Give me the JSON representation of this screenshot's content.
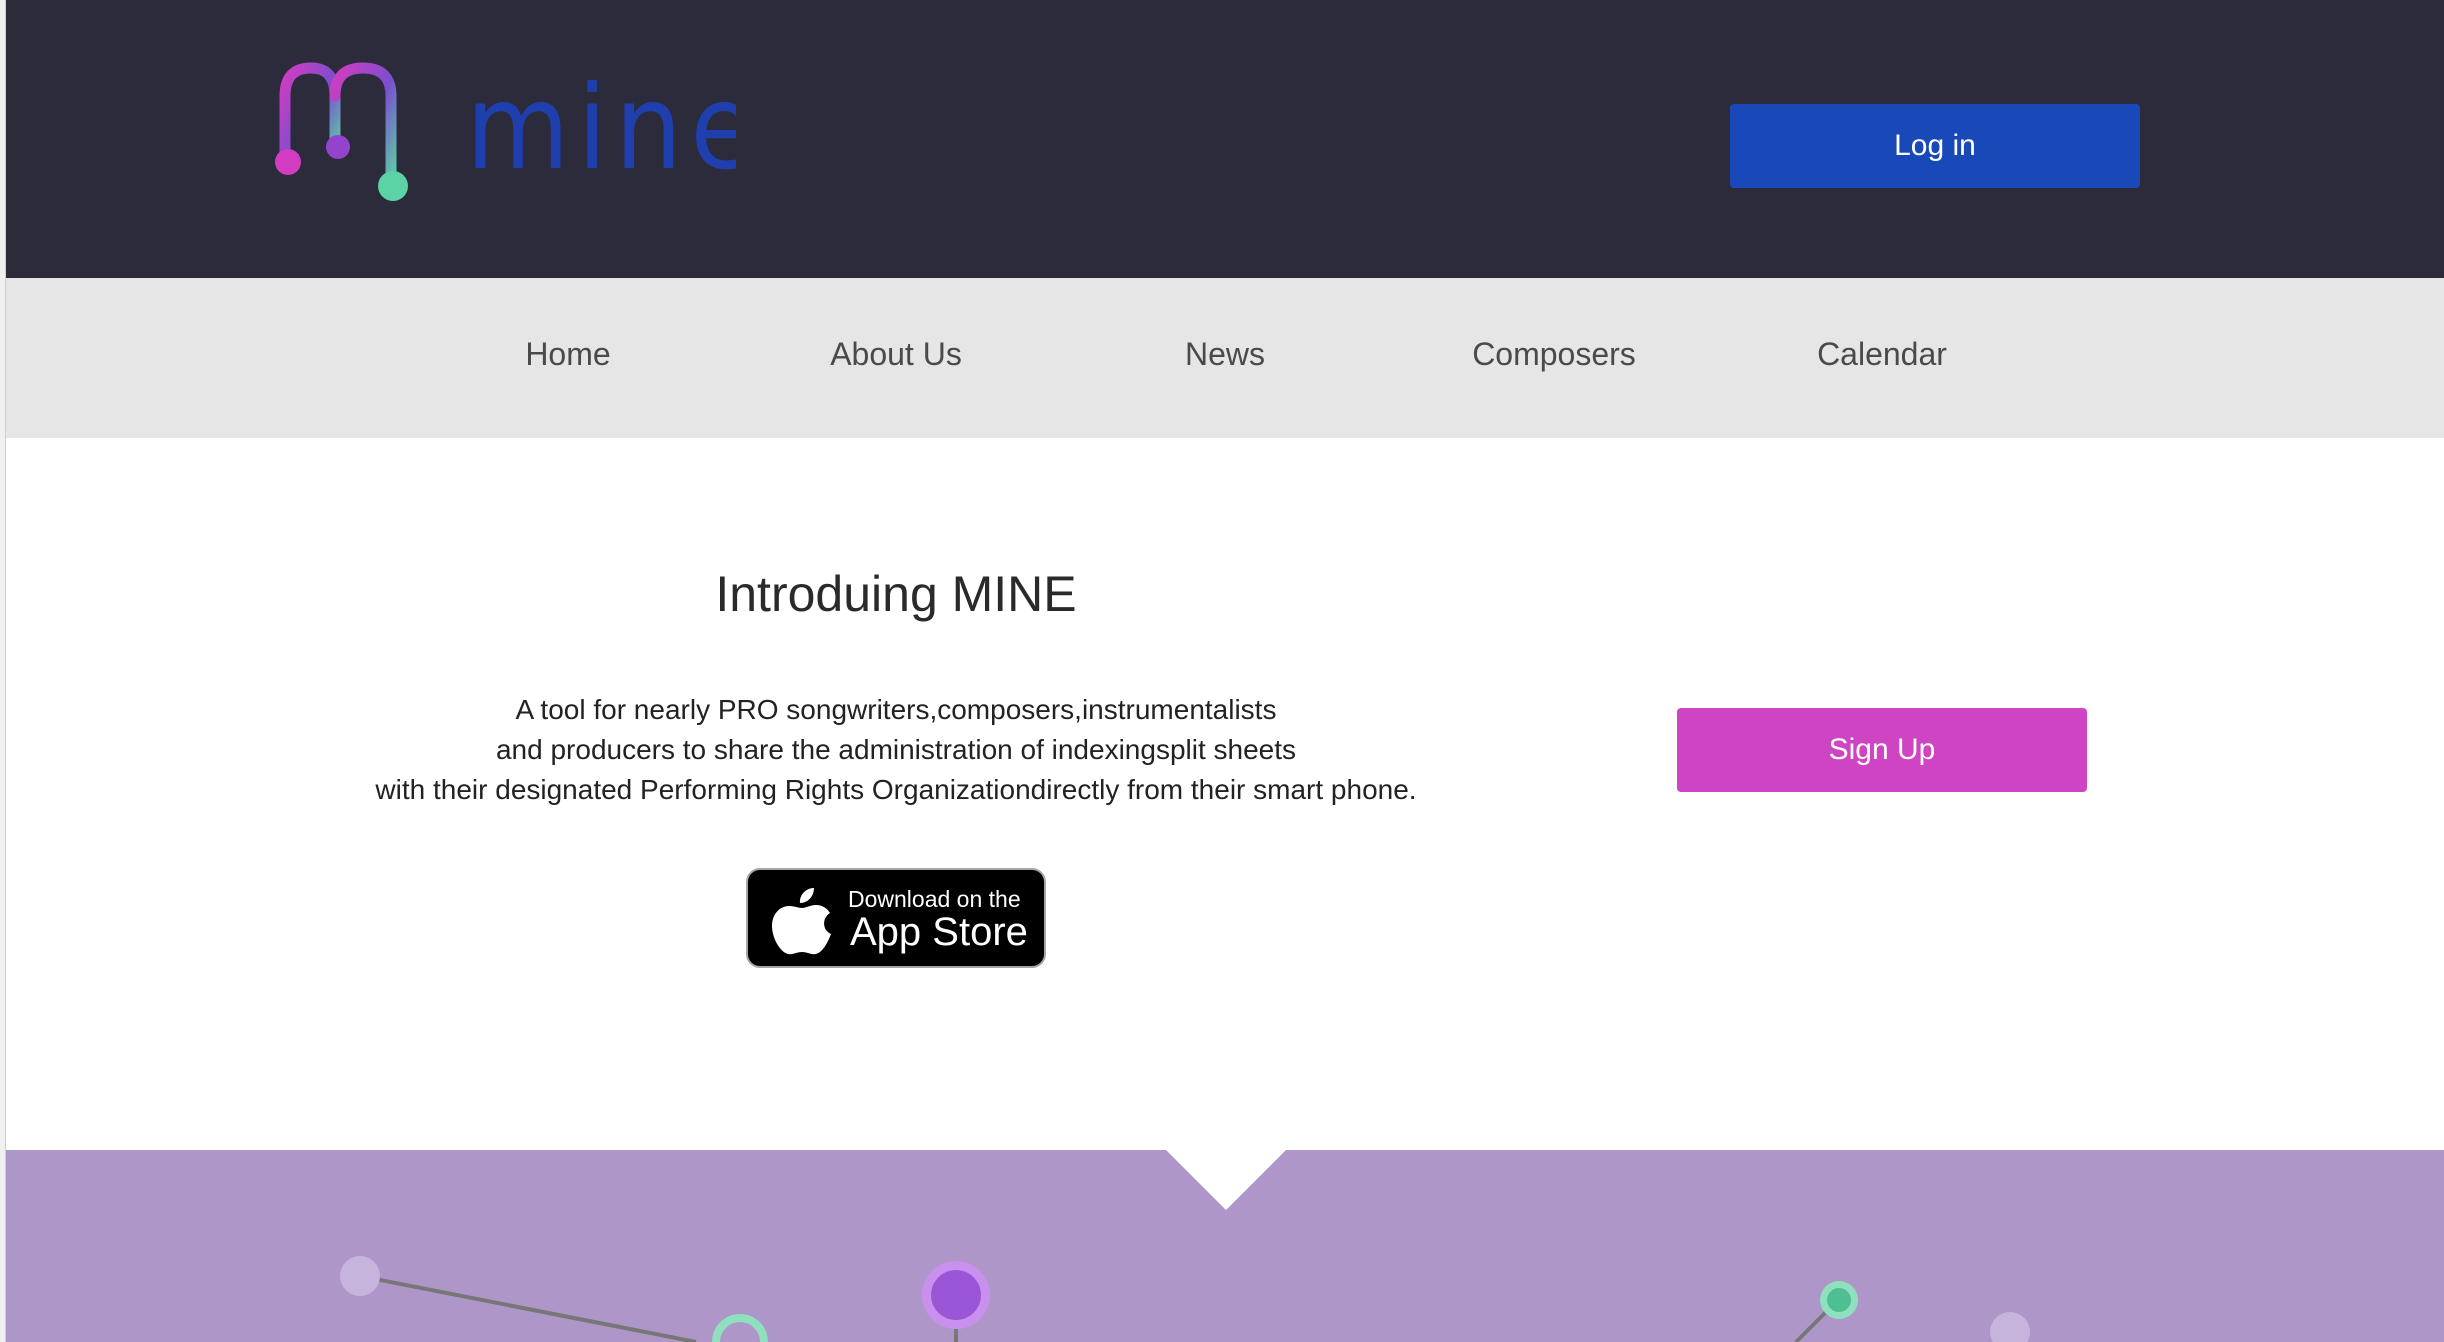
{
  "header": {
    "logo_text": "mine",
    "login_label": "Log in"
  },
  "nav": {
    "items": [
      {
        "label": "Home"
      },
      {
        "label": "About Us"
      },
      {
        "label": "News"
      },
      {
        "label": "Composers"
      },
      {
        "label": "Calendar"
      }
    ]
  },
  "intro": {
    "title": "Introduing MINE",
    "lines": [
      "A tool for nearly PRO songwriters,composers,instrumentalists",
      "and producers to share the administration of indexingsplit sheets",
      "with their designated Performing Rights Organizationdirectly from their smart phone."
    ],
    "appstore_small": "Download on the",
    "appstore_big": "App Store"
  },
  "signup_label": "Sign Up",
  "colors": {
    "header_bg": "#2c2b3c",
    "login_bg": "#1948b8",
    "nav_bg": "#e6e6e6",
    "signup_bg": "#cf44c2",
    "band_bg": "#ae97c8",
    "logo_word": "#1f3fae"
  },
  "icons": {
    "logo": "music-note-m-logo-icon",
    "apple": "apple-icon"
  }
}
